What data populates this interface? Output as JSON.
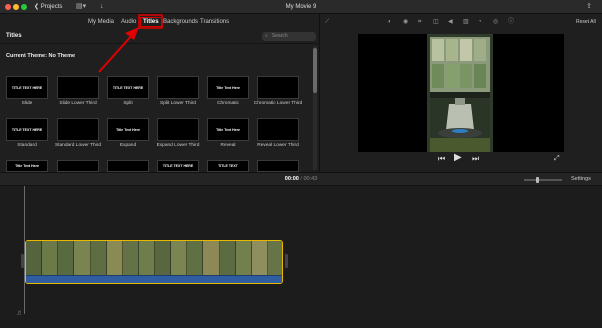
{
  "titlebar": {
    "projects_label": "❮ Projects",
    "app_title": "My Movie 9",
    "share_icon": "share-icon"
  },
  "browser": {
    "tabs": [
      {
        "label": "My Media"
      },
      {
        "label": "Audio"
      },
      {
        "label": "Titles",
        "active": true
      },
      {
        "label": "Backgrounds"
      },
      {
        "label": "Transitions"
      }
    ],
    "section_title": "Titles",
    "search_placeholder": "Search",
    "theme_label": "Current Theme: No Theme",
    "tiles": [
      {
        "label": "Slide",
        "thumb": "TITLE TEXT HERE"
      },
      {
        "label": "Slide Lower Third",
        "thumb": ""
      },
      {
        "label": "Split",
        "thumb": "TITLE TEXT HERE"
      },
      {
        "label": "Split Lower Third",
        "thumb": ""
      },
      {
        "label": "Chromatic",
        "thumb": "Title Text Here"
      },
      {
        "label": "Chromatic Lower Third",
        "thumb": ""
      },
      {
        "label": "Standard",
        "thumb": "TITLE TEXT HERE"
      },
      {
        "label": "Standard Lower Third",
        "thumb": ""
      },
      {
        "label": "Expand",
        "thumb": "Title Text Here"
      },
      {
        "label": "Expand Lower Third",
        "thumb": ""
      },
      {
        "label": "Reveal",
        "thumb": "Title Text Here"
      },
      {
        "label": "Reveal Lower Third",
        "thumb": ""
      },
      {
        "label": "",
        "thumb": "Title Text Here"
      },
      {
        "label": "",
        "thumb": ""
      },
      {
        "label": "",
        "thumb": ""
      },
      {
        "label": "",
        "thumb": "TITLE TEXT HERE"
      },
      {
        "label": "",
        "thumb": "TITLE TEXT"
      },
      {
        "label": "",
        "thumb": ""
      }
    ]
  },
  "viewer": {
    "reset_label": "Reset All"
  },
  "timeline_bar": {
    "current_time": "00:00",
    "separator": "/",
    "total_time": "00:43",
    "settings_label": "Settings"
  },
  "colors": {
    "clip_border": "#e8b800",
    "audio_track": "#2f5da0",
    "annotation": "#e00000"
  }
}
